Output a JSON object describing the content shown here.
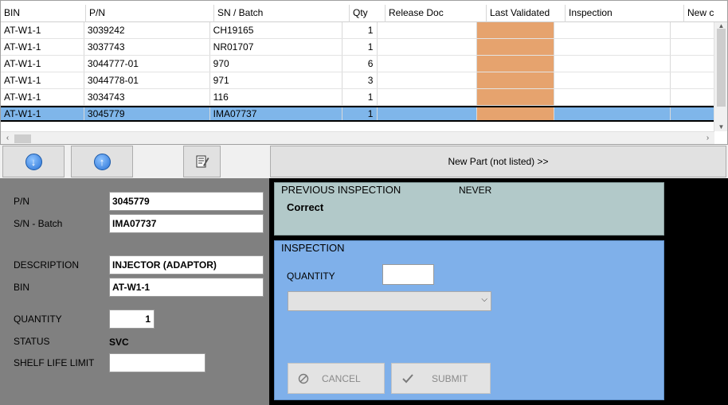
{
  "grid": {
    "columns": [
      "BIN",
      "P/N",
      "SN / Batch",
      "Qty",
      "Release Doc",
      "Last Validated",
      "Inspection",
      "New c"
    ],
    "rows": [
      {
        "bin": "AT-W1-1",
        "pn": "3039242",
        "sn": "CH19165",
        "qty": "1",
        "release_doc": "",
        "last_validated": "",
        "inspection": "",
        "new": ""
      },
      {
        "bin": "AT-W1-1",
        "pn": "3037743",
        "sn": "NR01707",
        "qty": "1",
        "release_doc": "",
        "last_validated": "",
        "inspection": "",
        "new": ""
      },
      {
        "bin": "AT-W1-1",
        "pn": "3044777-01",
        "sn": "970",
        "qty": "6",
        "release_doc": "",
        "last_validated": "",
        "inspection": "",
        "new": ""
      },
      {
        "bin": "AT-W1-1",
        "pn": "3044778-01",
        "sn": "971",
        "qty": "3",
        "release_doc": "",
        "last_validated": "",
        "inspection": "",
        "new": ""
      },
      {
        "bin": "AT-W1-1",
        "pn": "3034743",
        "sn": "116",
        "qty": "1",
        "release_doc": "",
        "last_validated": "",
        "inspection": "",
        "new": ""
      },
      {
        "bin": "AT-W1-1",
        "pn": "3045779",
        "sn": "IMA07737",
        "qty": "1",
        "release_doc": "",
        "last_validated": "",
        "inspection": "",
        "new": ""
      }
    ],
    "selected_row": 5,
    "colors": {
      "validated_cell": "#e6a36e",
      "selected_row": "#7fb6ea"
    }
  },
  "toolbar": {
    "down_icon": "arrow-down-circle-icon",
    "up_icon": "arrow-up-circle-icon",
    "edit_icon": "edit-document-icon",
    "new_part_label": "New Part (not listed) >>"
  },
  "details": {
    "pn_label": "P/N",
    "pn_value": "3045779",
    "sn_label": "S/N - Batch",
    "sn_value": "IMA07737",
    "description_label": "DESCRIPTION",
    "description_value": "INJECTOR (ADAPTOR)",
    "bin_label": "BIN",
    "bin_value": "AT-W1-1",
    "quantity_label": "QUANTITY",
    "quantity_value": "1",
    "status_label": "STATUS",
    "status_value": "SVC",
    "shelf_label": "SHELF LIFE LIMIT",
    "shelf_value": ""
  },
  "previous_inspection": {
    "title": "PREVIOUS INSPECTION",
    "when": "NEVER",
    "result": "Correct"
  },
  "inspection": {
    "title": "INSPECTION",
    "quantity_label": "QUANTITY",
    "quantity_value": "",
    "select_value": "",
    "cancel_label": "CANCEL",
    "submit_label": "SUBMIT"
  }
}
